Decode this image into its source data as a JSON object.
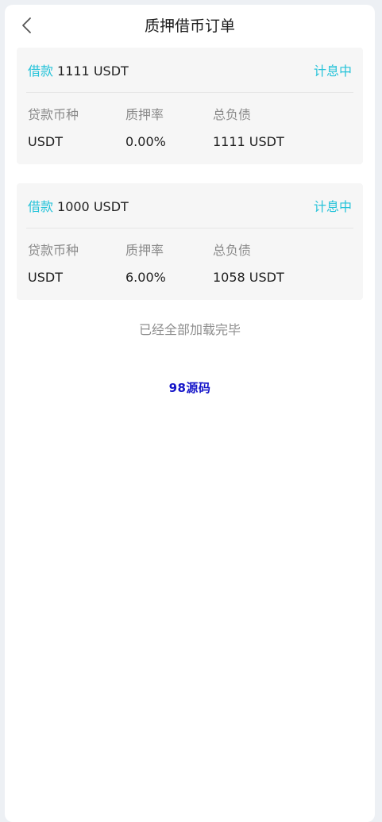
{
  "header": {
    "title": "质押借币订单"
  },
  "orders": [
    {
      "loan_label": "借款",
      "loan_amount": "1111 USDT",
      "status": "计息中",
      "fields": {
        "currency_label": "贷款币种",
        "currency_value": "USDT",
        "rate_label": "质押率",
        "rate_value": "0.00%",
        "debt_label": "总负债",
        "debt_value": "1111 USDT"
      }
    },
    {
      "loan_label": "借款",
      "loan_amount": "1000 USDT",
      "status": "计息中",
      "fields": {
        "currency_label": "贷款币种",
        "currency_value": "USDT",
        "rate_label": "质押率",
        "rate_value": "6.00%",
        "debt_label": "总负债",
        "debt_value": "1058 USDT"
      }
    }
  ],
  "footer": {
    "end_text": "已经全部加载完毕",
    "watermark": "98源码"
  },
  "colors": {
    "accent": "#26c3d9",
    "watermark": "#1515c9"
  },
  "icons": {
    "back": "chevron-left-icon"
  }
}
